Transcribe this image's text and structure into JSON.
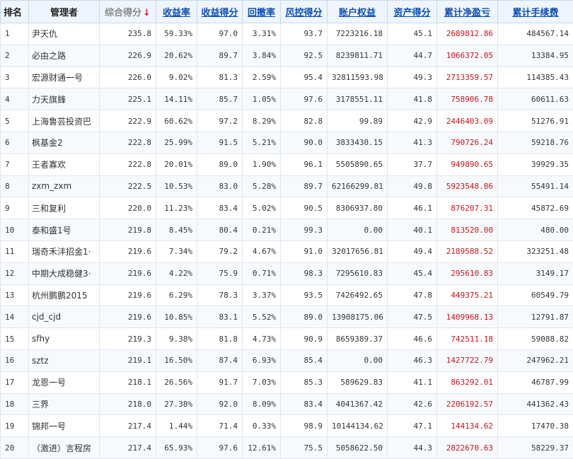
{
  "headers": {
    "rank": "排名",
    "manager": "管理者",
    "score": "综合得分",
    "score_arrow": "↓",
    "return_rate": "收益率",
    "return_score": "收益得分",
    "drawdown": "回撤率",
    "risk_score": "风控得分",
    "equity": "账户权益",
    "asset_score": "资产得分",
    "net_profit": "累计净盈亏",
    "fees": "累计手续费"
  },
  "colors": {
    "header_bg": "#eef5fc",
    "link": "#0d4fb5",
    "profit_red": "#d0101a",
    "sort_arrow": "#e01b1b"
  },
  "rows": [
    {
      "rank": "1",
      "manager": "尹天仇",
      "score": "235.8",
      "return_rate": "59.33%",
      "return_score": "97.0",
      "drawdown": "3.31%",
      "risk_score": "93.7",
      "equity": "7223216.18",
      "asset_score": "45.1",
      "net_profit": "2689812.86",
      "fees": "484567.14"
    },
    {
      "rank": "2",
      "manager": "必由之路",
      "score": "226.9",
      "return_rate": "20.62%",
      "return_score": "89.7",
      "drawdown": "3.84%",
      "risk_score": "92.5",
      "equity": "8239811.71",
      "asset_score": "44.7",
      "net_profit": "1066372.05",
      "fees": "13384.95"
    },
    {
      "rank": "3",
      "manager": "宏源财通一号",
      "score": "226.0",
      "return_rate": "9.02%",
      "return_score": "81.3",
      "drawdown": "2.59%",
      "risk_score": "95.4",
      "equity": "32811593.98",
      "asset_score": "49.3",
      "net_profit": "2713359.57",
      "fees": "114385.43"
    },
    {
      "rank": "4",
      "manager": "力天旗鋒",
      "score": "225.1",
      "return_rate": "14.11%",
      "return_score": "85.7",
      "drawdown": "1.05%",
      "risk_score": "97.6",
      "equity": "3178551.11",
      "asset_score": "41.8",
      "net_profit": "758906.78",
      "fees": "60611.63"
    },
    {
      "rank": "5",
      "manager": "上海鲁芸投资巴",
      "score": "222.9",
      "return_rate": "60.62%",
      "return_score": "97.2",
      "drawdown": "8.29%",
      "risk_score": "82.8",
      "equity": "99.89",
      "asset_score": "42.9",
      "net_profit": "2446403.09",
      "fees": "51276.91"
    },
    {
      "rank": "6",
      "manager": "枫基金2",
      "score": "222.8",
      "return_rate": "25.99%",
      "return_score": "91.5",
      "drawdown": "5.21%",
      "risk_score": "90.0",
      "equity": "3833430.15",
      "asset_score": "41.3",
      "net_profit": "790726.24",
      "fees": "59218.76"
    },
    {
      "rank": "7",
      "manager": "王者寡欢",
      "score": "222.8",
      "return_rate": "20.01%",
      "return_score": "89.0",
      "drawdown": "1.90%",
      "risk_score": "96.1",
      "equity": "5505890.65",
      "asset_score": "37.7",
      "net_profit": "949890.65",
      "fees": "39929.35"
    },
    {
      "rank": "8",
      "manager": "zxm_zxm",
      "score": "222.5",
      "return_rate": "10.53%",
      "return_score": "83.0",
      "drawdown": "5.28%",
      "risk_score": "89.7",
      "equity": "62166299.81",
      "asset_score": "49.8",
      "net_profit": "5923548.86",
      "fees": "55491.14"
    },
    {
      "rank": "9",
      "manager": "三和复利",
      "score": "220.0",
      "return_rate": "11.23%",
      "return_score": "83.4",
      "drawdown": "5.02%",
      "risk_score": "90.5",
      "equity": "8306937.80",
      "asset_score": "46.1",
      "net_profit": "876207.31",
      "fees": "45872.69"
    },
    {
      "rank": "10",
      "manager": "泰和盛1号",
      "score": "219.8",
      "return_rate": "8.45%",
      "return_score": "80.4",
      "drawdown": "0.21%",
      "risk_score": "99.3",
      "equity": "0.00",
      "asset_score": "40.1",
      "net_profit": "813520.00",
      "fees": "480.00"
    },
    {
      "rank": "11",
      "manager": "瑞奇禾沣招金1·",
      "score": "219.6",
      "return_rate": "7.34%",
      "return_score": "79.2",
      "drawdown": "4.67%",
      "risk_score": "91.0",
      "equity": "32017656.81",
      "asset_score": "49.4",
      "net_profit": "2189588.52",
      "fees": "323251.48"
    },
    {
      "rank": "12",
      "manager": "中期大成稳健3·",
      "score": "219.6",
      "return_rate": "4.22%",
      "return_score": "75.9",
      "drawdown": "0.71%",
      "risk_score": "98.3",
      "equity": "7295610.83",
      "asset_score": "45.4",
      "net_profit": "295610.83",
      "fees": "3149.17"
    },
    {
      "rank": "13",
      "manager": "杭州鹏鹏2015",
      "score": "219.6",
      "return_rate": "6.29%",
      "return_score": "78.3",
      "drawdown": "3.37%",
      "risk_score": "93.5",
      "equity": "7426492.65",
      "asset_score": "47.8",
      "net_profit": "449375.21",
      "fees": "60549.79"
    },
    {
      "rank": "14",
      "manager": "cjd_cjd",
      "score": "219.6",
      "return_rate": "10.85%",
      "return_score": "83.1",
      "drawdown": "5.52%",
      "risk_score": "89.0",
      "equity": "13908175.06",
      "asset_score": "47.5",
      "net_profit": "1409968.13",
      "fees": "12791.87"
    },
    {
      "rank": "15",
      "manager": "sfhy",
      "score": "219.3",
      "return_rate": "9.38%",
      "return_score": "81.8",
      "drawdown": "4.73%",
      "risk_score": "90.9",
      "equity": "8659389.37",
      "asset_score": "46.6",
      "net_profit": "742511.18",
      "fees": "59088.82"
    },
    {
      "rank": "16",
      "manager": "sztz",
      "score": "219.1",
      "return_rate": "16.50%",
      "return_score": "87.4",
      "drawdown": "6.93%",
      "risk_score": "85.4",
      "equity": "0.00",
      "asset_score": "46.3",
      "net_profit": "1427722.79",
      "fees": "247962.21"
    },
    {
      "rank": "17",
      "manager": "龙恩一号",
      "score": "218.1",
      "return_rate": "26.56%",
      "return_score": "91.7",
      "drawdown": "7.03%",
      "risk_score": "85.3",
      "equity": "589629.83",
      "asset_score": "41.1",
      "net_profit": "863292.01",
      "fees": "46787.99"
    },
    {
      "rank": "18",
      "manager": "三界",
      "score": "218.0",
      "return_rate": "27.38%",
      "return_score": "92.0",
      "drawdown": "8.09%",
      "risk_score": "83.4",
      "equity": "4041367.42",
      "asset_score": "42.6",
      "net_profit": "2206192.57",
      "fees": "441362.43"
    },
    {
      "rank": "19",
      "manager": "锦邦一号",
      "score": "217.4",
      "return_rate": "1.44%",
      "return_score": "71.4",
      "drawdown": "0.33%",
      "risk_score": "98.9",
      "equity": "10144134.62",
      "asset_score": "47.1",
      "net_profit": "144134.62",
      "fees": "17470.38"
    },
    {
      "rank": "20",
      "manager": "（激进）言程房",
      "score": "217.4",
      "return_rate": "65.93%",
      "return_score": "97.6",
      "drawdown": "12.61%",
      "risk_score": "75.5",
      "equity": "5058622.50",
      "asset_score": "44.3",
      "net_profit": "2822670.63",
      "fees": "58229.37"
    }
  ]
}
